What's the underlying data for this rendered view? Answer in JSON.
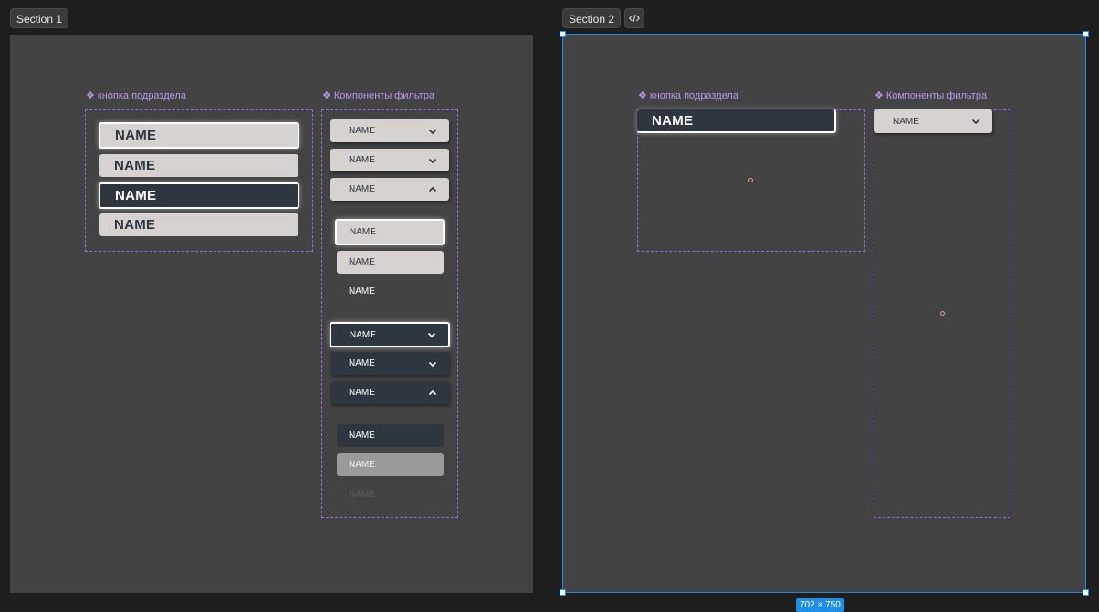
{
  "section1": {
    "tab_label": "Section 1",
    "subsection_button": {
      "label": "кнопка подраздела",
      "buttons": [
        "NAME",
        "NAME",
        "NAME",
        "NAME"
      ]
    },
    "filter": {
      "label": "Компоненты фильтра",
      "dropdowns_light": [
        "NAME",
        "NAME",
        "NAME"
      ],
      "options_light": [
        "NAME",
        "NAME",
        "NAME"
      ],
      "dropdowns_dark": [
        "NAME",
        "NAME",
        "NAME"
      ],
      "options_dark": [
        "NAME",
        "NAME",
        "NAME"
      ]
    }
  },
  "section2": {
    "tab_label": "Section 2",
    "code_icon": "code-icon",
    "subsection_button": {
      "label": "кнопка подраздела",
      "button": "NAME"
    },
    "filter": {
      "label": "Компоненты фильтра",
      "dropdown": "NAME"
    },
    "size_badge": "702 × 750"
  },
  "colors": {
    "canvas": "#1e1e1e",
    "frame": "#434343",
    "component_outline": "#9a6adf",
    "selection": "#1d8fe8",
    "light_button": "#d6d2d0",
    "dark_button": "#2e3640"
  }
}
